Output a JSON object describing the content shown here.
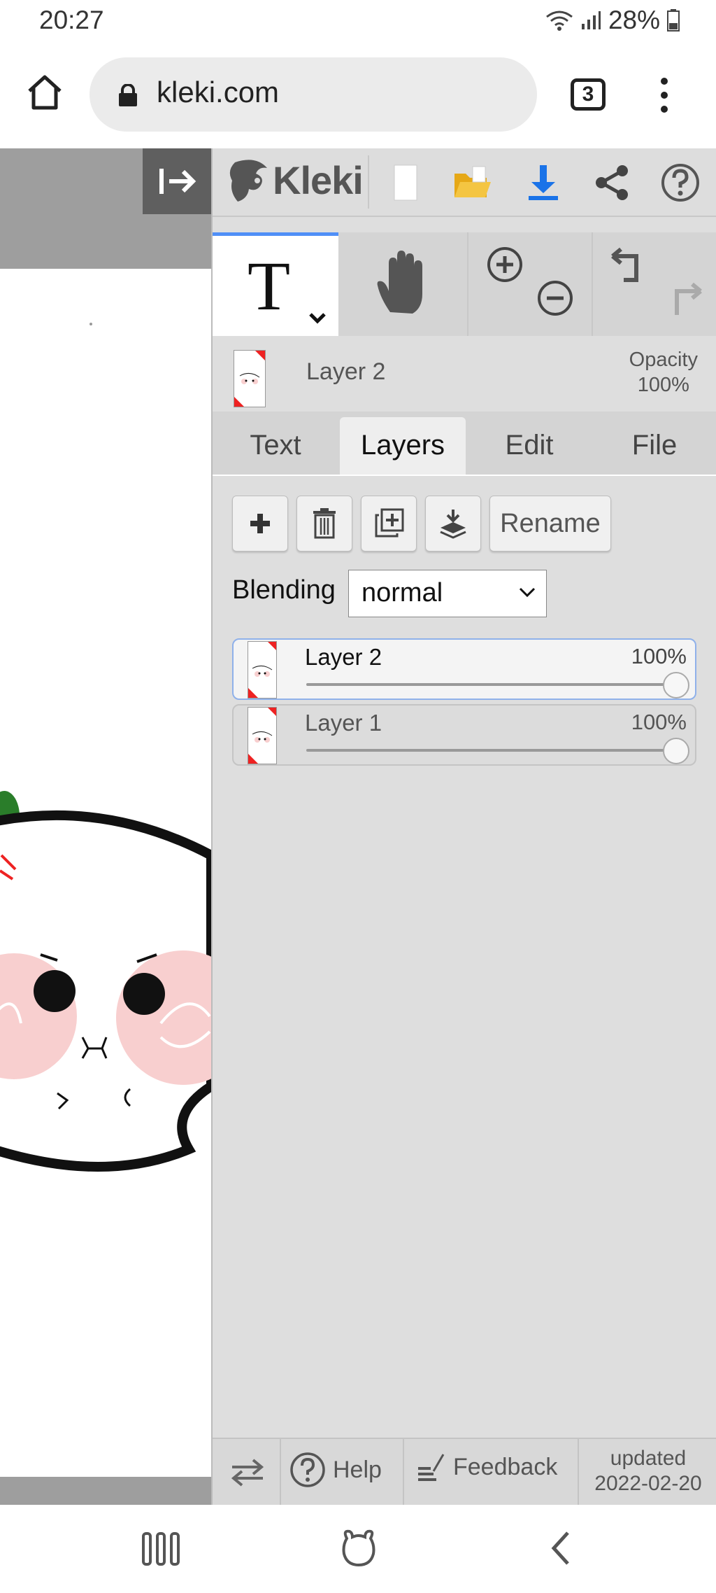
{
  "status": {
    "time": "20:27",
    "battery": "28%"
  },
  "browser": {
    "url": "kleki.com",
    "tab_count": "3"
  },
  "app": {
    "logo": "Kleki",
    "current_layer": {
      "name": "Layer 2",
      "opacity_label": "Opacity",
      "opacity_value": "100%"
    },
    "tabs": [
      "Text",
      "Layers",
      "Edit",
      "File"
    ],
    "active_tab": "Layers",
    "layers_panel": {
      "rename_label": "Rename",
      "blending_label": "Blending",
      "blending_value": "normal",
      "layers": [
        {
          "name": "Layer 2",
          "opacity": "100%",
          "selected": true
        },
        {
          "name": "Layer 1",
          "opacity": "100%",
          "selected": false
        }
      ]
    },
    "footer": {
      "help": "Help",
      "feedback": "Feedback",
      "updated_label": "updated",
      "updated_date": "2022-02-20"
    }
  },
  "colors": {
    "accent": "#4f8ff7",
    "download": "#1a73e8",
    "folder": "#f4c542",
    "panel": "#dedede"
  }
}
